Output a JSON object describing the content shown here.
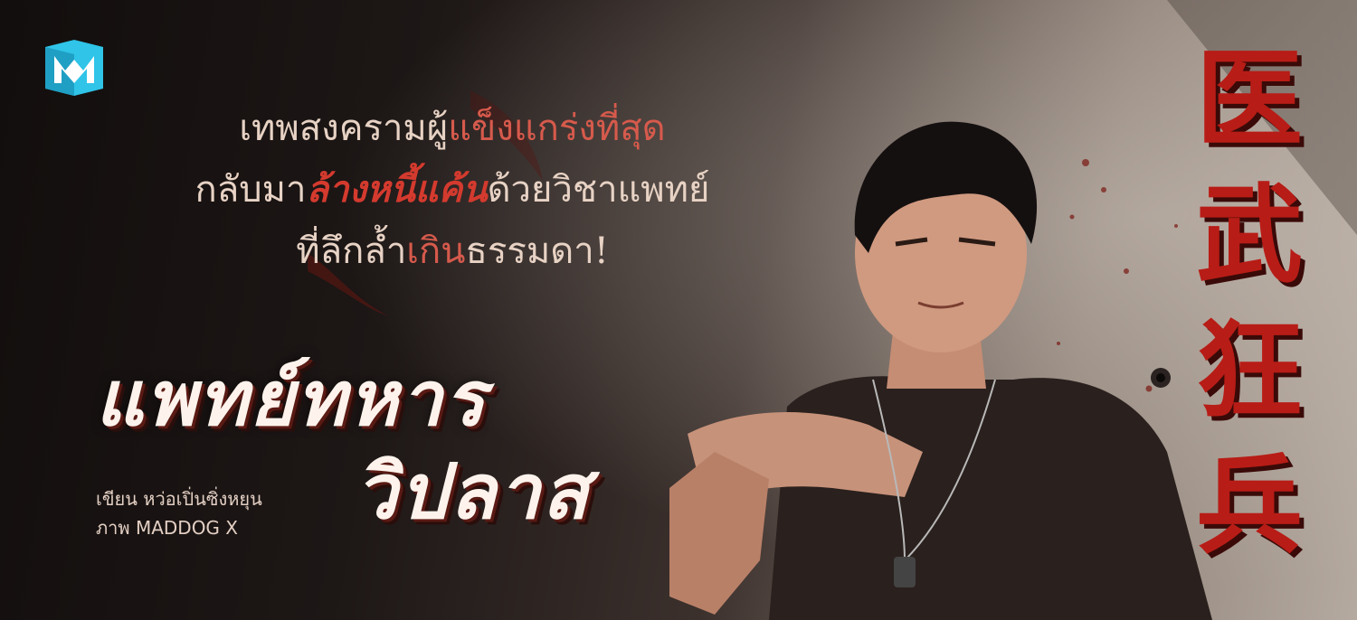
{
  "brand": {
    "logo_icon": "book-m-logo-icon"
  },
  "tagline": {
    "line1_a": "เทพสงครามผู้",
    "line1_b": "แข็งแกร่งที่สุด",
    "line2_a": "กลับมา",
    "line2_b": "ล้างหนี้แค้น",
    "line2_c": "ด้วยวิชาแพทย์",
    "line3_a": "ที่ลึกล้ำ",
    "line3_b": "เกิน",
    "line3_c": "ธรรมดา!"
  },
  "title": {
    "line1": "แพทย์ทหาร",
    "line2": "วิปลาส"
  },
  "credits": {
    "writer": "เขียน หว่อเปิ่นซิ่งหยุน",
    "artist": "ภาพ MADDOG X"
  },
  "chinese_title": [
    "医",
    "武",
    "狂",
    "兵"
  ],
  "colors": {
    "accent_red": "#c8281e",
    "cream": "#fdf3ec",
    "logo_cyan": "#2fc4e8"
  }
}
